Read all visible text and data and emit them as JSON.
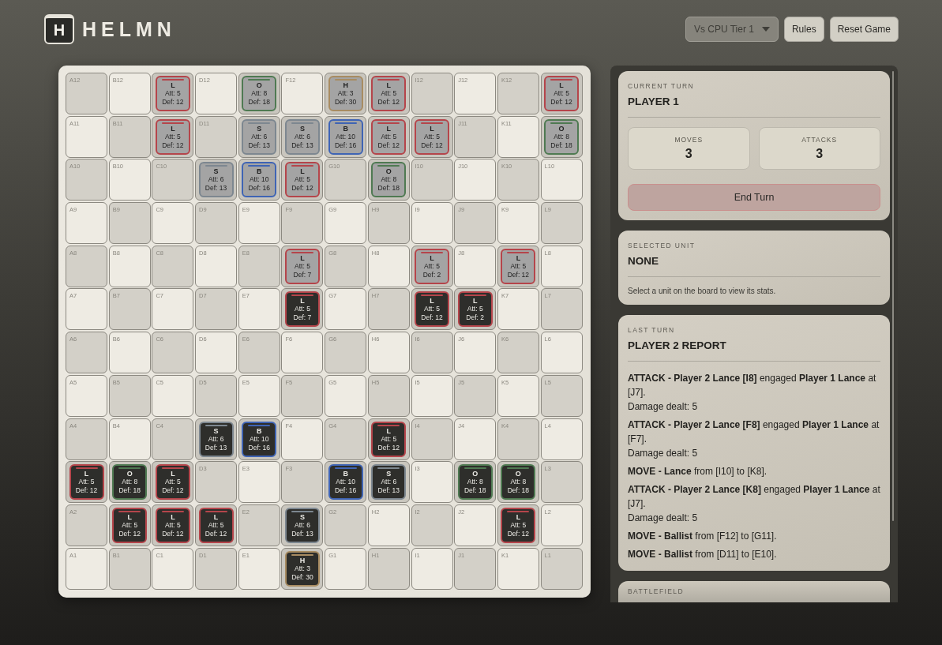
{
  "logo": {
    "mark": "H",
    "name": "HELMN"
  },
  "controls": {
    "mode_select": {
      "value": "Vs CPU Tier 1"
    },
    "buttons": [
      "Rules",
      "Reset Game"
    ]
  },
  "board": {
    "rows": [
      {
        "cells": [
          {
            "label": "A12"
          },
          {
            "label": "B12"
          },
          {
            "unit": {
              "kind": "lance",
              "symbol": "L",
              "attack": "Att: 5",
              "defense": "Def: 12",
              "opponent": true
            }
          },
          {
            "label": "D12"
          },
          {
            "unit": {
              "kind": "outrider",
              "symbol": "O",
              "attack": "Att: 8",
              "defense": "Def: 18",
              "opponent": true
            }
          },
          {
            "label": "F12"
          },
          {
            "unit": {
              "kind": "helm",
              "symbol": "H",
              "attack": "Att: 3",
              "defense": "Def: 30",
              "opponent": true
            }
          },
          {
            "unit": {
              "kind": "lance",
              "symbol": "L",
              "attack": "Att: 5",
              "defense": "Def: 12",
              "opponent": true
            }
          },
          {
            "label": "I12"
          },
          {
            "label": "J12"
          },
          {
            "label": "K12"
          },
          {
            "unit": {
              "kind": "lance",
              "symbol": "L",
              "attack": "Att: 5",
              "defense": "Def: 12",
              "opponent": true
            }
          }
        ]
      },
      {
        "cells": [
          {
            "label": "A11"
          },
          {
            "label": "B11"
          },
          {
            "unit": {
              "kind": "lance",
              "symbol": "L",
              "attack": "Att: 5",
              "defense": "Def: 12",
              "opponent": true
            }
          },
          {
            "label": "D11"
          },
          {
            "unit": {
              "kind": "shield",
              "symbol": "S",
              "attack": "Att: 6",
              "defense": "Def: 13",
              "opponent": true
            }
          },
          {
            "unit": {
              "kind": "shield",
              "symbol": "S",
              "attack": "Att: 6",
              "defense": "Def: 13",
              "opponent": true
            }
          },
          {
            "unit": {
              "kind": "ballist",
              "symbol": "B",
              "attack": "Att: 10",
              "defense": "Def: 16",
              "opponent": true
            }
          },
          {
            "unit": {
              "kind": "lance",
              "symbol": "L",
              "attack": "Att: 5",
              "defense": "Def: 12",
              "opponent": true
            }
          },
          {
            "unit": {
              "kind": "lance",
              "symbol": "L",
              "attack": "Att: 5",
              "defense": "Def: 12",
              "opponent": true
            }
          },
          {
            "label": "J11"
          },
          {
            "label": "K11"
          },
          {
            "unit": {
              "kind": "outrider",
              "symbol": "O",
              "attack": "Att: 8",
              "defense": "Def: 18",
              "opponent": true
            }
          }
        ]
      },
      {
        "cells": [
          {
            "label": "A10"
          },
          {
            "label": "B10"
          },
          {
            "label": "C10"
          },
          {
            "unit": {
              "kind": "shield",
              "symbol": "S",
              "attack": "Att: 6",
              "defense": "Def: 13",
              "opponent": true
            }
          },
          {
            "unit": {
              "kind": "ballist",
              "symbol": "B",
              "attack": "Att: 10",
              "defense": "Def: 16",
              "opponent": true
            }
          },
          {
            "unit": {
              "kind": "lance",
              "symbol": "L",
              "attack": "Att: 5",
              "defense": "Def: 12",
              "opponent": true
            }
          },
          {
            "label": "G10"
          },
          {
            "unit": {
              "kind": "outrider",
              "symbol": "O",
              "attack": "Att: 8",
              "defense": "Def: 18",
              "opponent": true
            }
          },
          {
            "label": "I10"
          },
          {
            "label": "J10"
          },
          {
            "label": "K10"
          },
          {
            "label": "L10"
          }
        ]
      },
      {
        "cells": [
          {
            "label": "A9"
          },
          {
            "label": "B9"
          },
          {
            "label": "C9"
          },
          {
            "label": "D9"
          },
          {
            "label": "E9"
          },
          {
            "label": "F9"
          },
          {
            "label": "G9"
          },
          {
            "label": "H9"
          },
          {
            "label": "I9"
          },
          {
            "label": "J9"
          },
          {
            "label": "K9"
          },
          {
            "label": "L9"
          }
        ]
      },
      {
        "cells": [
          {
            "label": "A8"
          },
          {
            "label": "B8"
          },
          {
            "label": "C8"
          },
          {
            "label": "D8"
          },
          {
            "label": "E8"
          },
          {
            "unit": {
              "kind": "lance",
              "symbol": "L",
              "attack": "Att: 5",
              "defense": "Def: 7",
              "opponent": true
            }
          },
          {
            "label": "G8"
          },
          {
            "label": "H8"
          },
          {
            "unit": {
              "kind": "lance",
              "symbol": "L",
              "attack": "Att: 5",
              "defense": "Def: 2",
              "opponent": true
            }
          },
          {
            "label": "J8"
          },
          {
            "unit": {
              "kind": "lance",
              "symbol": "L",
              "attack": "Att: 5",
              "defense": "Def: 12",
              "opponent": true
            }
          },
          {
            "label": "L8"
          }
        ]
      },
      {
        "cells": [
          {
            "label": "A7"
          },
          {
            "label": "B7"
          },
          {
            "label": "C7"
          },
          {
            "label": "D7"
          },
          {
            "label": "E7"
          },
          {
            "unit": {
              "kind": "lance",
              "symbol": "L",
              "attack": "Att: 5",
              "defense": "Def: 7",
              "opponent": false
            }
          },
          {
            "label": "G7"
          },
          {
            "label": "H7"
          },
          {
            "unit": {
              "kind": "lance",
              "symbol": "L",
              "attack": "Att: 5",
              "defense": "Def: 12",
              "opponent": false
            }
          },
          {
            "unit": {
              "kind": "lance",
              "symbol": "L",
              "attack": "Att: 5",
              "defense": "Def: 2",
              "opponent": false
            }
          },
          {
            "label": "K7"
          },
          {
            "label": "L7"
          }
        ]
      },
      {
        "cells": [
          {
            "label": "A6"
          },
          {
            "label": "B6"
          },
          {
            "label": "C6"
          },
          {
            "label": "D6"
          },
          {
            "label": "E6"
          },
          {
            "label": "F6"
          },
          {
            "label": "G6"
          },
          {
            "label": "H6"
          },
          {
            "label": "I6"
          },
          {
            "label": "J6"
          },
          {
            "label": "K6"
          },
          {
            "label": "L6"
          }
        ]
      },
      {
        "cells": [
          {
            "label": "A5"
          },
          {
            "label": "B5"
          },
          {
            "label": "C5"
          },
          {
            "label": "D5"
          },
          {
            "label": "E5"
          },
          {
            "label": "F5"
          },
          {
            "label": "G5"
          },
          {
            "label": "H5"
          },
          {
            "label": "I5"
          },
          {
            "label": "J5"
          },
          {
            "label": "K5"
          },
          {
            "label": "L5"
          }
        ]
      },
      {
        "cells": [
          {
            "label": "A4"
          },
          {
            "label": "B4"
          },
          {
            "label": "C4"
          },
          {
            "unit": {
              "kind": "shield",
              "symbol": "S",
              "attack": "Att: 6",
              "defense": "Def: 13",
              "opponent": false
            }
          },
          {
            "unit": {
              "kind": "ballist",
              "symbol": "B",
              "attack": "Att: 10",
              "defense": "Def: 16",
              "opponent": false
            }
          },
          {
            "label": "F4"
          },
          {
            "label": "G4"
          },
          {
            "unit": {
              "kind": "lance",
              "symbol": "L",
              "attack": "Att: 5",
              "defense": "Def: 12",
              "opponent": false
            }
          },
          {
            "label": "I4"
          },
          {
            "label": "J4"
          },
          {
            "label": "K4"
          },
          {
            "label": "L4"
          }
        ]
      },
      {
        "cells": [
          {
            "unit": {
              "kind": "lance",
              "symbol": "L",
              "attack": "Att: 5",
              "defense": "Def: 12",
              "opponent": false
            }
          },
          {
            "unit": {
              "kind": "outrider",
              "symbol": "O",
              "attack": "Att: 8",
              "defense": "Def: 18",
              "opponent": false
            }
          },
          {
            "unit": {
              "kind": "lance",
              "symbol": "L",
              "attack": "Att: 5",
              "defense": "Def: 12",
              "opponent": false
            }
          },
          {
            "label": "D3"
          },
          {
            "label": "E3"
          },
          {
            "label": "F3"
          },
          {
            "unit": {
              "kind": "ballist",
              "symbol": "B",
              "attack": "Att: 10",
              "defense": "Def: 16",
              "opponent": false
            }
          },
          {
            "unit": {
              "kind": "shield",
              "symbol": "S",
              "attack": "Att: 6",
              "defense": "Def: 13",
              "opponent": false
            }
          },
          {
            "label": "I3"
          },
          {
            "unit": {
              "kind": "outrider",
              "symbol": "O",
              "attack": "Att: 8",
              "defense": "Def: 18",
              "opponent": false
            }
          },
          {
            "unit": {
              "kind": "outrider",
              "symbol": "O",
              "attack": "Att: 8",
              "defense": "Def: 18",
              "opponent": false
            }
          },
          {
            "label": "L3"
          }
        ]
      },
      {
        "cells": [
          {
            "label": "A2"
          },
          {
            "unit": {
              "kind": "lance",
              "symbol": "L",
              "attack": "Att: 5",
              "defense": "Def: 12",
              "opponent": false
            }
          },
          {
            "unit": {
              "kind": "lance",
              "symbol": "L",
              "attack": "Att: 5",
              "defense": "Def: 12",
              "opponent": false
            }
          },
          {
            "unit": {
              "kind": "lance",
              "symbol": "L",
              "attack": "Att: 5",
              "defense": "Def: 12",
              "opponent": false
            }
          },
          {
            "label": "E2"
          },
          {
            "unit": {
              "kind": "shield",
              "symbol": "S",
              "attack": "Att: 6",
              "defense": "Def: 13",
              "opponent": false
            }
          },
          {
            "label": "G2"
          },
          {
            "label": "H2"
          },
          {
            "label": "I2"
          },
          {
            "label": "J2"
          },
          {
            "unit": {
              "kind": "lance",
              "symbol": "L",
              "attack": "Att: 5",
              "defense": "Def: 12",
              "opponent": false
            }
          },
          {
            "label": "L2"
          }
        ]
      },
      {
        "cells": [
          {
            "label": "A1"
          },
          {
            "label": "B1"
          },
          {
            "label": "C1"
          },
          {
            "label": "D1"
          },
          {
            "label": "E1"
          },
          {
            "unit": {
              "kind": "helm",
              "symbol": "H",
              "attack": "Att: 3",
              "defense": "Def: 30",
              "opponent": false
            }
          },
          {
            "label": "G1"
          },
          {
            "label": "H1"
          },
          {
            "label": "I1"
          },
          {
            "label": "J1"
          },
          {
            "label": "K1"
          },
          {
            "label": "L1"
          }
        ]
      }
    ]
  },
  "current_turn": {
    "heading": "CURRENT TURN",
    "title": "PLAYER 1",
    "stats": [
      {
        "label": "MOVES",
        "value": "3"
      },
      {
        "label": "ATTACKS",
        "value": "3"
      }
    ],
    "button": "End Turn"
  },
  "selected_unit": {
    "heading": "SELECTED UNIT",
    "title": "NONE",
    "hint": "Select a unit on the board to view its stats."
  },
  "last_turn": {
    "heading": "LAST TURN",
    "title": "PLAYER 2 REPORT",
    "entries": [
      {
        "text": "**ATTACK - Player 2 Lance [I8]** engaged **Player 1 Lance** at [J7].",
        "detail": "Damage dealt: 5"
      },
      {
        "text": "**ATTACK - Player 2 Lance [F8]** engaged **Player 1 Lance** at [F7].",
        "detail": "Damage dealt: 5"
      },
      {
        "text": "**MOVE - Lance** from [I10] to [K8]."
      },
      {
        "text": "**ATTACK - Player 2 Lance [K8]** engaged **Player 1 Lance** at [J7].",
        "detail": "Damage dealt: 5"
      },
      {
        "text": "**MOVE - Ballist** from [F12] to [G11]."
      },
      {
        "text": "**MOVE - Ballist** from [D11] to [E10]."
      }
    ]
  },
  "battlefield": {
    "heading": "BATTLEFIELD"
  }
}
